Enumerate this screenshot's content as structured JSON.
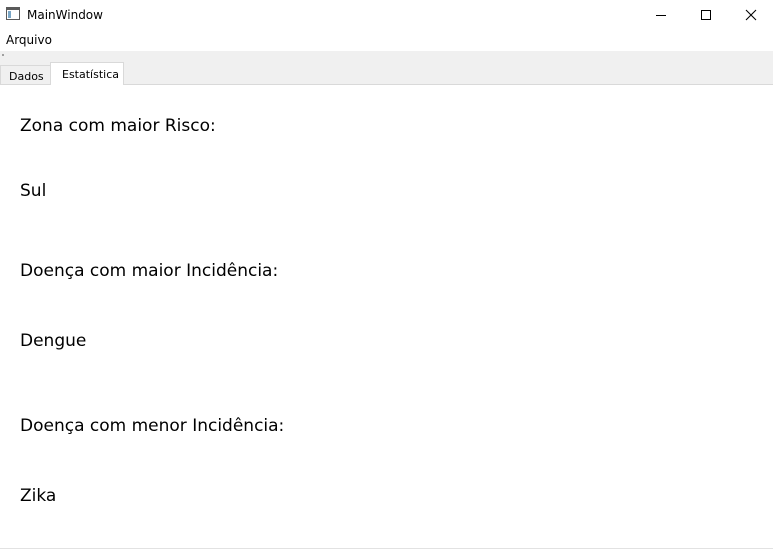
{
  "window": {
    "title": "MainWindow"
  },
  "menu": {
    "items": [
      "Arquivo"
    ]
  },
  "tabs": [
    {
      "label": "Dados",
      "selected": false
    },
    {
      "label": "Estatística",
      "selected": true
    }
  ],
  "stats": {
    "zone_risk_label": "Zona com maior Risco:",
    "zone_risk_value": "Sul",
    "max_incidence_label": "Doença com maior Incidência:",
    "max_incidence_value": "Dengue",
    "min_incidence_label": "Doença com menor Incidência:",
    "min_incidence_value": "Zika"
  }
}
